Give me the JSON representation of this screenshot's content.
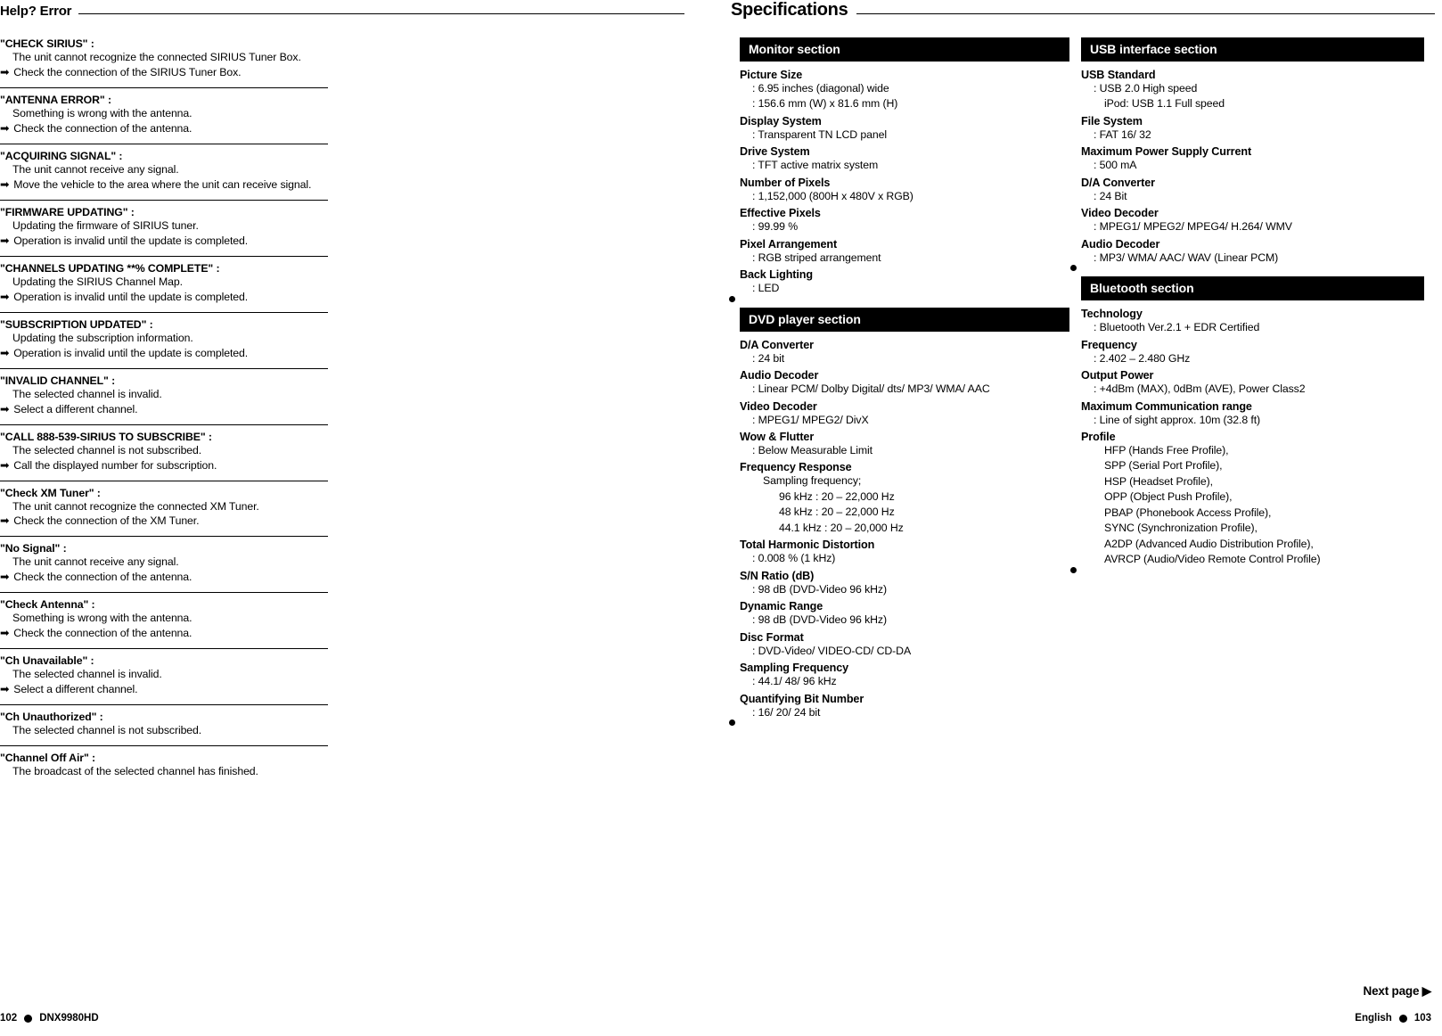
{
  "left": {
    "header": "Help? Error",
    "errors": [
      {
        "title": "\"CHECK SIRIUS\" :",
        "lines": [
          "The unit cannot recognize the connected SIRIUS Tuner Box."
        ],
        "arrows": [
          "Check the connection of the SIRIUS Tuner Box."
        ]
      },
      {
        "title": "\"ANTENNA ERROR\" :",
        "lines": [
          "Something is wrong with the antenna."
        ],
        "arrows": [
          "Check the connection of the antenna."
        ]
      },
      {
        "title": "\"ACQUIRING SIGNAL\" :",
        "lines": [
          "The unit cannot receive any signal."
        ],
        "arrows": [
          "Move the vehicle to the area where the unit can receive signal."
        ]
      },
      {
        "title": "\"FIRMWARE UPDATING\" :",
        "lines": [
          "Updating the firmware of SIRIUS tuner."
        ],
        "arrows": [
          "Operation is invalid until the update is completed."
        ]
      },
      {
        "title": "\"CHANNELS UPDATING **% COMPLETE\" :",
        "lines": [
          "Updating the SIRIUS Channel Map."
        ],
        "arrows": [
          "Operation is invalid until the update is completed."
        ]
      },
      {
        "title": "\"SUBSCRIPTION UPDATED\" :",
        "lines": [
          "Updating the subscription information."
        ],
        "arrows": [
          "Operation is invalid until the update is completed."
        ]
      },
      {
        "title": "\"INVALID CHANNEL\" :",
        "lines": [
          "The selected channel is invalid."
        ],
        "arrows": [
          "Select a different channel."
        ]
      },
      {
        "title": "\"CALL 888-539-SIRIUS TO SUBSCRIBE\" :",
        "lines": [
          "The selected channel is not subscribed."
        ],
        "arrows": [
          "Call the displayed number for subscription."
        ]
      },
      {
        "title": "\"Check XM Tuner\" :",
        "lines": [
          "The unit cannot recognize the connected XM Tuner."
        ],
        "arrows": [
          "Check the connection of the XM Tuner."
        ]
      },
      {
        "title": "\"No Signal\" :",
        "lines": [
          "The unit cannot receive any signal."
        ],
        "arrows": [
          "Check the connection of the antenna."
        ]
      },
      {
        "title": "\"Check Antenna\" :",
        "lines": [
          "Something is wrong with the antenna."
        ],
        "arrows": [
          "Check the connection of the antenna."
        ]
      },
      {
        "title": "\"Ch Unavailable\" :",
        "lines": [
          "The selected channel is invalid."
        ],
        "arrows": [
          "Select a different channel."
        ]
      },
      {
        "title": "\"Ch Unauthorized\" :",
        "lines": [
          "The selected channel is not subscribed."
        ],
        "arrows": []
      },
      {
        "title": "\"Channel Off Air\" :",
        "lines": [
          "The broadcast of the selected channel has finished."
        ],
        "arrows": []
      }
    ],
    "footer": {
      "page": "102",
      "model": "DNX9980HD"
    }
  },
  "right": {
    "header": "Specifications",
    "sections": [
      {
        "id": "monitor",
        "title": "Monitor section",
        "column": "a",
        "items": [
          {
            "key": "Picture Size",
            "values": [
              ": 6.95 inches (diagonal) wide",
              ": 156.6 mm (W) x 81.6 mm (H)"
            ]
          },
          {
            "key": "Display System",
            "values": [
              ": Transparent TN LCD panel"
            ]
          },
          {
            "key": "Drive System",
            "values": [
              ": TFT active matrix system"
            ]
          },
          {
            "key": "Number of Pixels",
            "values": [
              ": 1,152,000 (800H x 480V x RGB)"
            ]
          },
          {
            "key": "Effective Pixels",
            "values": [
              ": 99.99 %"
            ]
          },
          {
            "key": "Pixel Arrangement",
            "values": [
              ": RGB striped arrangement"
            ]
          },
          {
            "key": "Back Lighting",
            "values": [
              ": LED"
            ]
          }
        ]
      },
      {
        "id": "dvd",
        "title": "DVD player section",
        "column": "a",
        "items": [
          {
            "key": "D/A Converter",
            "values": [
              ": 24 bit"
            ]
          },
          {
            "key": "Audio Decoder",
            "values": [
              ": Linear PCM/ Dolby Digital/ dts/ MP3/ WMA/ AAC"
            ]
          },
          {
            "key": "Video Decoder",
            "values": [
              ": MPEG1/ MPEG2/ DivX"
            ]
          },
          {
            "key": "Wow & Flutter",
            "values": [
              ": Below Measurable Limit"
            ]
          },
          {
            "key": "Frequency Response",
            "values": [
              "Sampling frequency;"
            ],
            "sub": [
              "96 kHz : 20 – 22,000 Hz",
              "48 kHz : 20 – 22,000 Hz",
              "44.1 kHz : 20 – 20,000 Hz"
            ]
          },
          {
            "key": "Total Harmonic Distortion",
            "values": [
              ": 0.008 % (1 kHz)"
            ]
          },
          {
            "key": "S/N Ratio (dB)",
            "values": [
              ": 98 dB (DVD-Video 96 kHz)"
            ]
          },
          {
            "key": "Dynamic Range",
            "values": [
              ": 98 dB (DVD-Video 96 kHz)"
            ]
          },
          {
            "key": "Disc Format",
            "values": [
              ": DVD-Video/ VIDEO-CD/ CD-DA"
            ]
          },
          {
            "key": "Sampling Frequency",
            "values": [
              ": 44.1/ 48/ 96 kHz"
            ]
          },
          {
            "key": "Quantifying Bit Number",
            "values": [
              ": 16/ 20/ 24 bit"
            ]
          }
        ]
      },
      {
        "id": "usb",
        "title": "USB interface section",
        "column": "b",
        "items": [
          {
            "key": "USB Standard",
            "values": [
              ": USB 2.0 High speed",
              "iPod: USB 1.1 Full speed"
            ]
          },
          {
            "key": "File System",
            "values": [
              ": FAT 16/ 32"
            ]
          },
          {
            "key": "Maximum Power Supply Current",
            "values": [
              ": 500 mA"
            ]
          },
          {
            "key": "D/A Converter",
            "values": [
              ": 24 Bit"
            ]
          },
          {
            "key": "Video Decoder",
            "values": [
              ": MPEG1/ MPEG2/ MPEG4/ H.264/ WMV"
            ]
          },
          {
            "key": "Audio Decoder",
            "values": [
              ": MP3/ WMA/ AAC/ WAV (Linear PCM)"
            ]
          }
        ]
      },
      {
        "id": "bluetooth",
        "title": "Bluetooth section",
        "column": "b",
        "items": [
          {
            "key": "Technology",
            "values": [
              ": Bluetooth Ver.2.1 + EDR Certified"
            ]
          },
          {
            "key": "Frequency",
            "values": [
              ": 2.402 – 2.480 GHz"
            ]
          },
          {
            "key": "Output Power",
            "values": [
              ": +4dBm (MAX), 0dBm (AVE), Power Class2"
            ]
          },
          {
            "key": "Maximum Communication range",
            "values": [
              ": Line of sight approx. 10m (32.8 ft)"
            ]
          },
          {
            "key": "Profile",
            "values": [
              "HFP (Hands Free Profile),",
              "SPP (Serial Port Profile),",
              "HSP (Headset Profile),",
              "OPP (Object Push Profile),",
              "PBAP (Phonebook Access Profile),",
              "SYNC (Synchronization Profile),",
              "A2DP (Advanced Audio Distribution Profile),",
              "AVRCP (Audio/Video Remote Control Profile)"
            ]
          }
        ]
      }
    ],
    "next_page": "Next page ▶",
    "footer": {
      "language": "English",
      "page": "103"
    }
  }
}
